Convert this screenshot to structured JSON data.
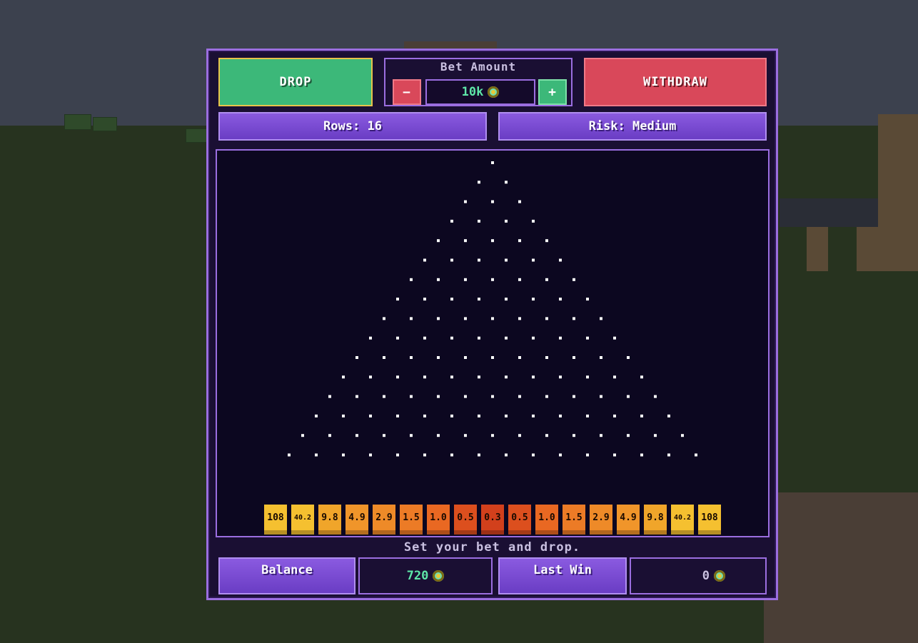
{
  "controls": {
    "drop_label": "DROP",
    "withdraw_label": "WITHDRAW",
    "bet_label": "Bet Amount",
    "bet_value": "10k",
    "minus_label": "−",
    "plus_label": "+",
    "rows_label": "Rows: 16",
    "risk_label": "Risk: Medium"
  },
  "board": {
    "rows": 16,
    "multipliers": [
      "108",
      "40.2",
      "9.8",
      "4.9",
      "2.9",
      "1.5",
      "1.0",
      "0.5",
      "0.3",
      "0.5",
      "1.0",
      "1.5",
      "2.9",
      "4.9",
      "9.8",
      "40.2",
      "108"
    ],
    "bucket_colors": [
      "#f5c030",
      "#f5c030",
      "#f0a52a",
      "#f0952a",
      "#ee8a28",
      "#ec7b26",
      "#e96822",
      "#dc4f1e",
      "#d2401c",
      "#dc4f1e",
      "#e96822",
      "#ec7b26",
      "#ee8a28",
      "#f0952a",
      "#f0a52a",
      "#f5c030",
      "#f5c030"
    ],
    "peg_color": "#ffffff"
  },
  "status": "Set your bet and drop.",
  "footer": {
    "balance_label": "Balance",
    "balance_value": "720",
    "last_win_label": "Last Win",
    "last_win_value": "0"
  }
}
